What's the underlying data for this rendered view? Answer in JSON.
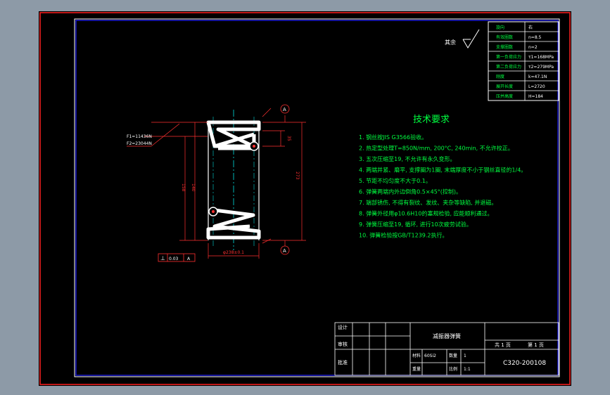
{
  "colors": {
    "frame": "#ff2020",
    "border": "#ffffff",
    "inner_border": "#2020ff",
    "text": "#00ff40",
    "dimension": "#ff3030",
    "part": "#ffffff",
    "centerline": "#00ffff",
    "title": "#ffffff"
  },
  "param_table": [
    {
      "label": "旋向",
      "value": "右"
    },
    {
      "label": "有效圈数",
      "value": "n=8.5"
    },
    {
      "label": "支撑圈数",
      "value": "n=2"
    },
    {
      "label": "第一负荷应力",
      "value": "τ1=168MPa"
    },
    {
      "label": "第二负荷应力",
      "value": "τ2=279MPa"
    },
    {
      "label": "刚度",
      "value": "k=47.1N"
    },
    {
      "label": "展开长度",
      "value": "L=2720"
    },
    {
      "label": "压并高度",
      "value": "H=184"
    }
  ],
  "roughness_label": "其余",
  "load_labels": {
    "f1": "F1=11436N",
    "f2": "F2=23044N"
  },
  "datum_label": "A",
  "tolerance": {
    "symbol": "⊥",
    "value": "0.03",
    "datum": "A"
  },
  "dimensions": {
    "pitch": "35",
    "total_height": "273",
    "height_1": "158",
    "height_2": "140",
    "diameter": "φ238±0.1"
  },
  "tech_title": "技术要求",
  "tech_lines": [
    "1. 钢丝按JIS G3566验收。",
    "2. 热定型处理T=850N/mm, 200°C, 240min, 不允许校正。",
    "3. 五次压缩至19, 不允许有永久变形。",
    "4. 两端并紧、磨平, 支撑圈为1圈, 末端厚度不小于钢丝直径的1/4。",
    "5. 节距不均匀度不大于0.1。",
    "6. 弹簧两端内外边倒角0.5×45°(控制)。",
    "7. 端部锈伤, 不得有裂纹、发纹、夹杂等缺陷, 并退磁。",
    "8. 弹簧外径用φ10.6H10的塞规检验, 应能顺利通过。",
    "9. 弹簧压缩至19, 循环, 进行10次疲劳试验。",
    "10. 弹簧检验按GB/T1239.2执行。"
  ],
  "title_block": {
    "design": "设计",
    "check": "审核",
    "approve": "批准",
    "part_name": "减振器弹簧",
    "material_label": "材料",
    "material_value": "60Si2",
    "quantity_label": "数量",
    "quantity_value": "1",
    "weight_label": "重量",
    "scale_label": "比例",
    "scale_value": "1:1",
    "sheets": "共 1 页",
    "sheet_no": "第 1 页",
    "drawing_no": "C320-200108"
  }
}
